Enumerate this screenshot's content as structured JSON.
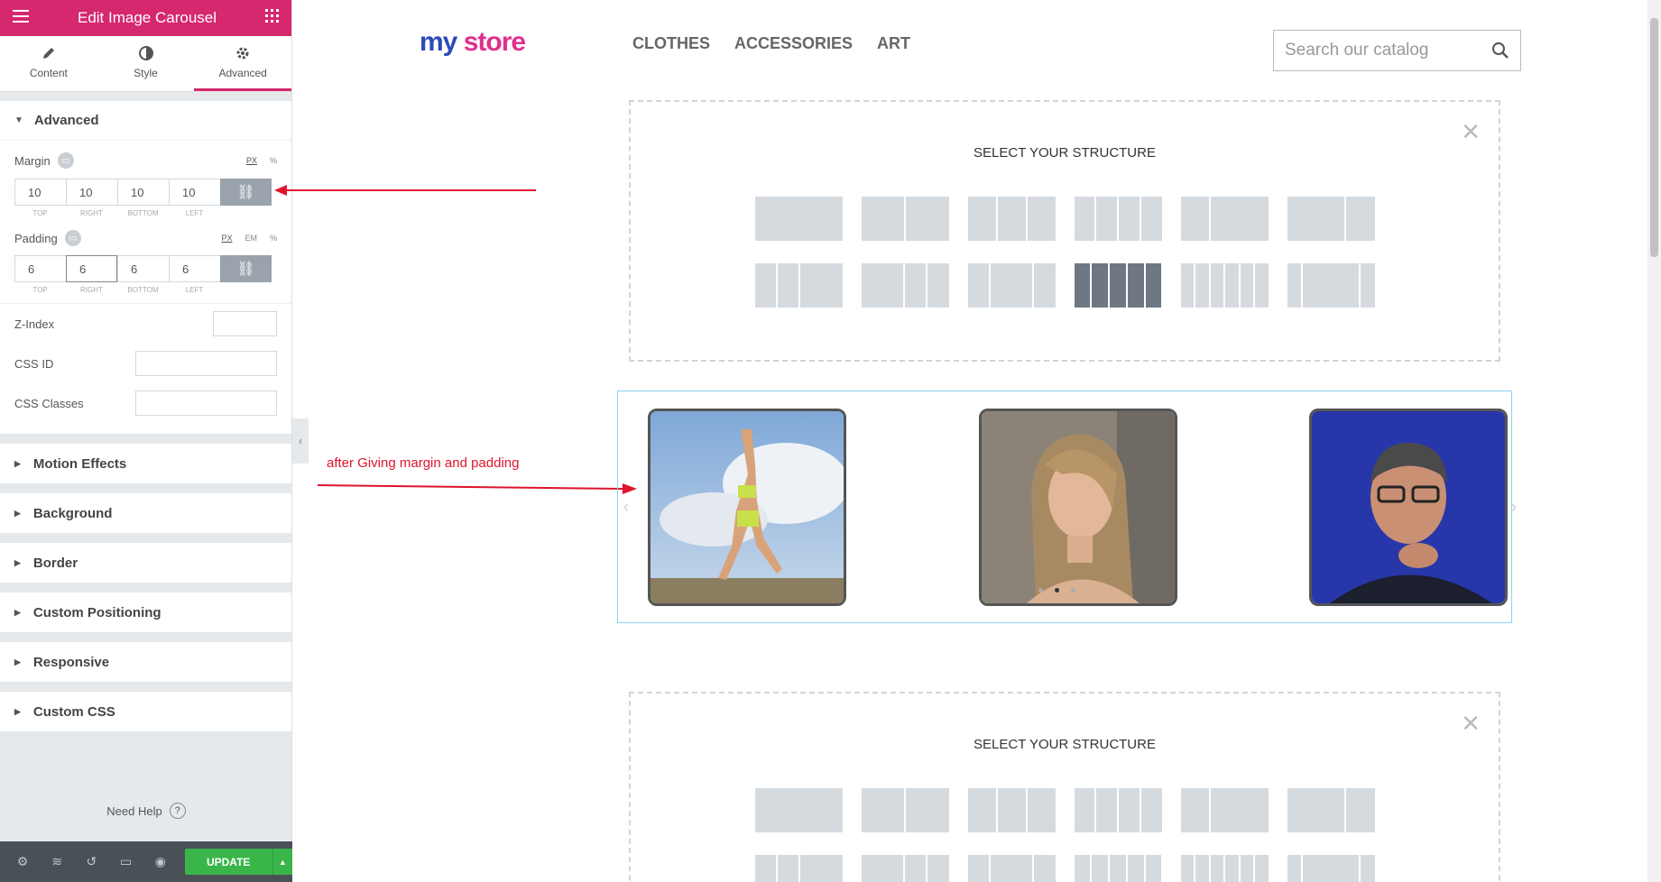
{
  "sidebar": {
    "title": "Edit Image Carousel",
    "tabs": [
      {
        "label": "Content",
        "icon": "pencil-icon"
      },
      {
        "label": "Style",
        "icon": "half-circle-icon"
      },
      {
        "label": "Advanced",
        "icon": "gear-icon"
      }
    ],
    "active_tab": "Advanced",
    "advanced": {
      "heading": "Advanced",
      "margin": {
        "label": "Margin",
        "units": [
          "PX",
          "%"
        ],
        "active_unit": "PX",
        "values": [
          "10",
          "10",
          "10",
          "10"
        ],
        "sides": [
          "TOP",
          "RIGHT",
          "BOTTOM",
          "LEFT"
        ]
      },
      "padding": {
        "label": "Padding",
        "units": [
          "PX",
          "EM",
          "%"
        ],
        "active_unit": "PX",
        "values": [
          "6",
          "6",
          "6",
          "6"
        ],
        "sides": [
          "TOP",
          "RIGHT",
          "BOTTOM",
          "LEFT"
        ]
      },
      "z_index_label": "Z-Index",
      "css_id_label": "CSS ID",
      "css_classes_label": "CSS Classes"
    },
    "sections": [
      "Motion Effects",
      "Background",
      "Border",
      "Custom Positioning",
      "Responsive",
      "Custom CSS"
    ],
    "need_help": "Need Help",
    "update_label": "UPDATE",
    "accent_color": "#d5286e",
    "update_color": "#39b54a"
  },
  "store": {
    "logo_part1": "my",
    "logo_part2": "store",
    "nav": [
      "CLOTHES",
      "ACCESSORIES",
      "ART"
    ],
    "search_placeholder": "Search our catalog"
  },
  "canvas": {
    "structure_title": "SELECT YOUR STRUCTURE",
    "annotation": "after Giving margin and padding",
    "carousel_slides": [
      "woman-stretching-outdoors",
      "woman-long-hair-portrait",
      "man-glasses-portrait"
    ],
    "carousel_dot_count": 3,
    "carousel_active_dot": 2
  }
}
